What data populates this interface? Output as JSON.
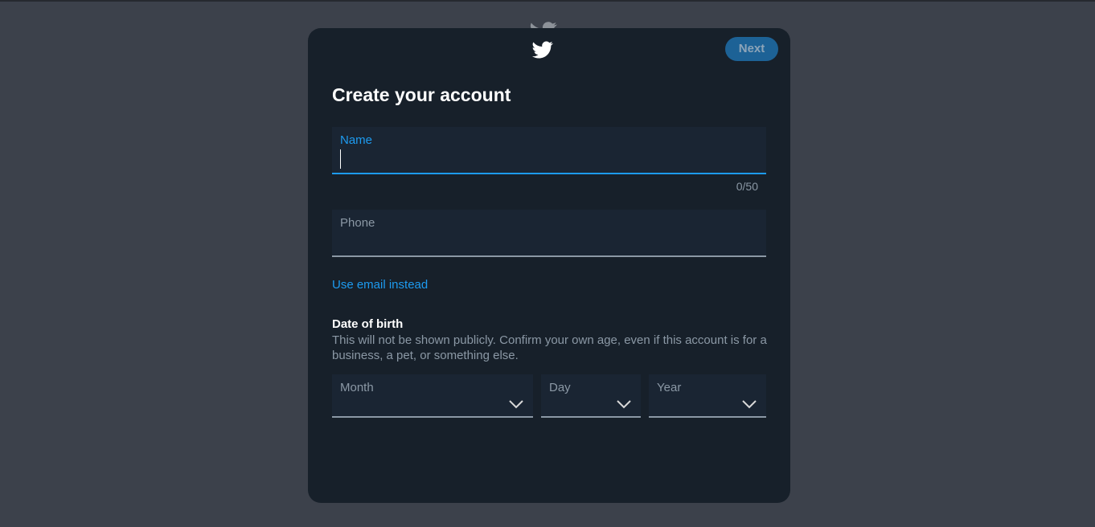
{
  "header": {
    "next_label": "Next",
    "logo_icon": "twitter-bird-icon"
  },
  "form": {
    "title": "Create your account",
    "name": {
      "label": "Name",
      "value": "",
      "counter": "0/50"
    },
    "phone": {
      "label": "Phone",
      "value": ""
    },
    "email_link": "Use email instead"
  },
  "dob": {
    "title": "Date of birth",
    "description": "This will not be shown publicly. Confirm your own age, even if this account is for a business, a pet, or something else.",
    "month_label": "Month",
    "day_label": "Day",
    "year_label": "Year"
  },
  "colors": {
    "accent": "#1d9bf0",
    "modal_bg": "#17202a",
    "page_bg": "#3c414b",
    "button_bg": "#1d6296"
  }
}
